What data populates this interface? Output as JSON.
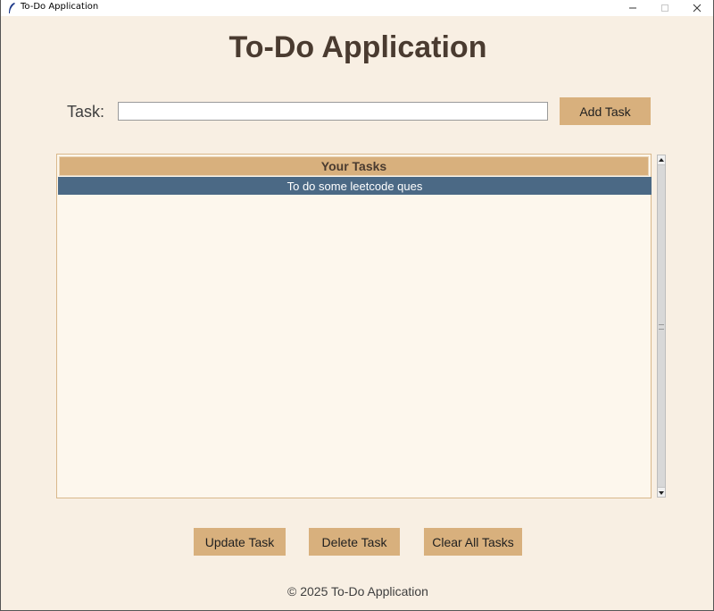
{
  "window": {
    "title": "To-Do Application",
    "controls": {
      "minimize": "—",
      "maximize": "☐",
      "close": "✕"
    }
  },
  "app": {
    "heading": "To-Do Application",
    "task_label": "Task:",
    "task_input_value": "",
    "add_button": "Add Task"
  },
  "task_list": {
    "header": "Your Tasks",
    "items": [
      {
        "text": "To do some leetcode ques",
        "selected": true
      }
    ]
  },
  "actions": {
    "update_button": "Update Task",
    "delete_button": "Delete Task",
    "clear_button": "Clear All Tasks"
  },
  "footer": "© 2025 To-Do Application",
  "colors": {
    "window_bg": "#f8efe3",
    "button_bg": "#d8b07d",
    "heading_text": "#4a3b30",
    "list_bg": "#fdf7ed",
    "selected_row": "#4b6985"
  },
  "icons": {
    "app_icon": "feather-icon",
    "scroll_up": "triangle-up-icon",
    "scroll_down": "triangle-down-icon"
  }
}
